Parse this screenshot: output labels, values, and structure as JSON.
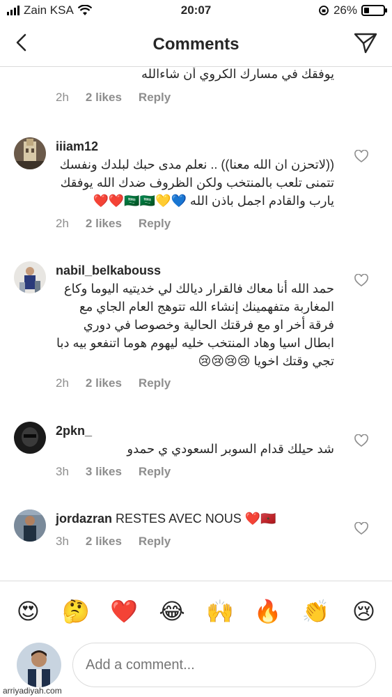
{
  "status_bar": {
    "carrier": "Zain KSA",
    "time": "20:07",
    "battery": "26%",
    "battery_level": 0.26
  },
  "header": {
    "title": "Comments"
  },
  "comments": [
    {
      "username": "",
      "text": "يوفقك في مسارك الكروي أن شاءالله",
      "time": "2h",
      "likes": "2 likes",
      "reply": "Reply"
    },
    {
      "username": "iiiam12",
      "text": "((لاتحزن ان الله معنا)) .. نعلم مدى حبك لبلدك ونفسك تتمنى تلعب بالمنتخب ولكن الظروف ضدك الله يوفقك يارب والقادم اجمل باذن الله 💙💛🇸🇦🇸🇦❤️❤️",
      "time": "2h",
      "likes": "2 likes",
      "reply": "Reply"
    },
    {
      "username": "nabil_belkabouss",
      "text": "حمد الله أنا معاك فالقرار ديالك لي خديتيه اليوما وكاع المغاربة متفهمينك إنشاء الله تتوهج العام الجاي مع فرقة أخر او مع فرقتك الحالية وخصوصا في دوري ابطال اسيا وهاد المنتخب خليه ليهوم هوما اتنفعو بيه دبا تجي وقتك اخويا 😢😢😢😢",
      "time": "2h",
      "likes": "2 likes",
      "reply": "Reply"
    },
    {
      "username": "2pkn_",
      "text": "شد حيلك قدام السوبر السعودي ي حمدو",
      "time": "3h",
      "likes": "3 likes",
      "reply": "Reply"
    },
    {
      "username": "jordazran",
      "text": "RESTES AVEC NOUS ❤️🇲🇦",
      "time": "3h",
      "likes": "2 likes",
      "reply": "Reply"
    }
  ],
  "emoji_bar": [
    "😍",
    "🤔",
    "❤️",
    "😂",
    "🙌",
    "🔥",
    "👏",
    "😢"
  ],
  "composer": {
    "placeholder": "Add a comment..."
  },
  "watermark": "arriyadiyah.com"
}
